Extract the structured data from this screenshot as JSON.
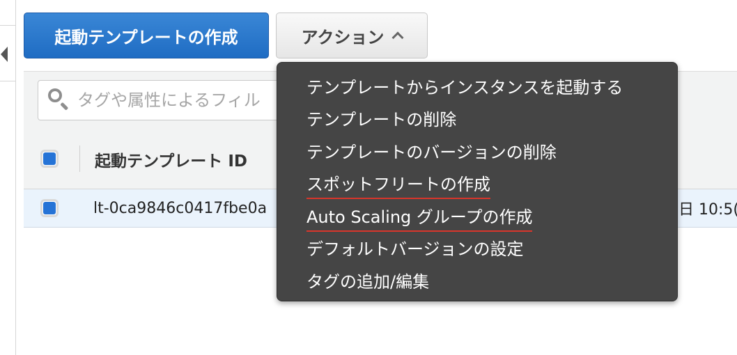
{
  "toolbar": {
    "create_label": "起動テンプレートの作成",
    "actions_label": "アクション"
  },
  "search": {
    "placeholder": "タグや属性によるフィル"
  },
  "table": {
    "header": {
      "id_column": "起動テンプレート ID"
    },
    "rows": [
      {
        "id": "lt-0ca9846c0417fbe0a",
        "date_partial": "日 10:5("
      }
    ]
  },
  "menu": {
    "items": [
      {
        "label": "テンプレートからインスタンスを起動する",
        "underlined": false
      },
      {
        "label": "テンプレートの削除",
        "underlined": false
      },
      {
        "label": "テンプレートのバージョンの削除",
        "underlined": false
      },
      {
        "label": "スポットフリートの作成",
        "underlined": true
      },
      {
        "label": "Auto Scaling グループの作成",
        "underlined": true
      },
      {
        "label": "デフォルトバージョンの設定",
        "underlined": false
      },
      {
        "label": "タグの追加/編集",
        "underlined": false
      }
    ]
  },
  "colors": {
    "primary_button": "#1f6cc3",
    "menu_background": "#454545",
    "selected_row": "#eaf3fc",
    "checkbox_fill": "#2573d6",
    "annotation_underline": "#d9352b"
  }
}
